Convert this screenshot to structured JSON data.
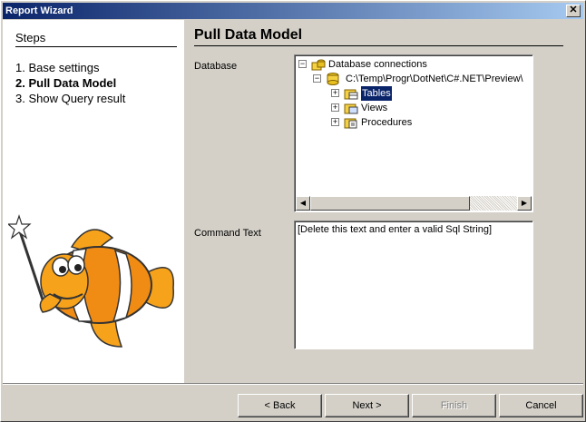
{
  "window": {
    "title": "Report Wizard",
    "close_glyph": "✕"
  },
  "steps": {
    "title": "Steps",
    "items": [
      {
        "label": "1. Base settings"
      },
      {
        "label": "2. Pull Data Model"
      },
      {
        "label": "3. Show Query result"
      }
    ],
    "active_index": 1
  },
  "page": {
    "title": "Pull Data Model",
    "database_label": "Database",
    "command_label": "Command Text"
  },
  "tree": {
    "root": "Database connections",
    "connection": "C:\\Temp\\Progr\\DotNet\\C#.NET\\Preview\\",
    "children": [
      {
        "label": "Tables",
        "icon": "tables-folder-icon"
      },
      {
        "label": "Views",
        "icon": "views-folder-icon"
      },
      {
        "label": "Procedures",
        "icon": "procedures-folder-icon"
      }
    ],
    "selected": "Tables"
  },
  "command": {
    "value": "[Delete this text and enter a valid Sql String]"
  },
  "buttons": {
    "back": "< Back",
    "next": "Next >",
    "finish": "Finish",
    "cancel": "Cancel"
  },
  "colors": {
    "titlebar_start": "#0a246a",
    "titlebar_end": "#a6caf0",
    "face": "#d4d0c8",
    "selection": "#0a246a"
  }
}
